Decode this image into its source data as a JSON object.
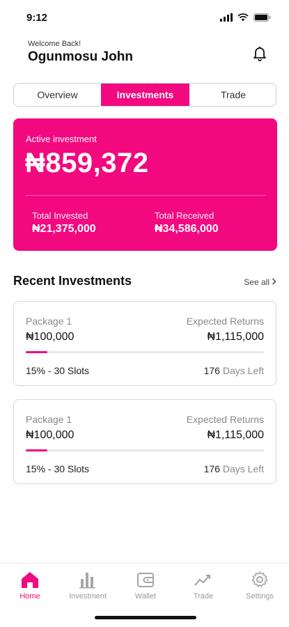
{
  "status_bar": {
    "time": "9:12"
  },
  "header": {
    "welcome": "Welcome Back!",
    "username": "Ogunmosu John"
  },
  "tabs": [
    {
      "label": "Overview",
      "active": false
    },
    {
      "label": "Investments",
      "active": true
    },
    {
      "label": "Trade",
      "active": false
    }
  ],
  "summary": {
    "label": "Active investment",
    "amount": "₦859,372",
    "total_invested_label": "Total Invested",
    "total_invested": "₦21,375,000",
    "total_received_label": "Total Received",
    "total_received": "₦34,586,000"
  },
  "recent": {
    "title": "Recent Investments",
    "see_all": "See all",
    "packages": [
      {
        "name": "Package 1",
        "amount": "₦100,000",
        "returns_label": "Expected Returns",
        "returns": "₦1,115,000",
        "rate": "15% - 30 Slots",
        "days": "176",
        "days_suffix": "Days Left",
        "progress_fraction": 0.09
      },
      {
        "name": "Package 1",
        "amount": "₦100,000",
        "returns_label": "Expected Returns",
        "returns": "₦1,115,000",
        "rate": "15% - 30 Slots",
        "days": "176",
        "days_suffix": "Days Left",
        "progress_fraction": 0.09
      }
    ]
  },
  "nav": [
    {
      "label": "Home",
      "icon": "home-icon",
      "active": true
    },
    {
      "label": "Investment",
      "icon": "bar-chart-icon",
      "active": false
    },
    {
      "label": "Wallet",
      "icon": "wallet-icon",
      "active": false
    },
    {
      "label": "Trade",
      "icon": "trend-icon",
      "active": false
    },
    {
      "label": "Settings",
      "icon": "gear-icon",
      "active": false
    }
  ],
  "colors": {
    "accent": "#f2097f",
    "muted": "#888888"
  }
}
